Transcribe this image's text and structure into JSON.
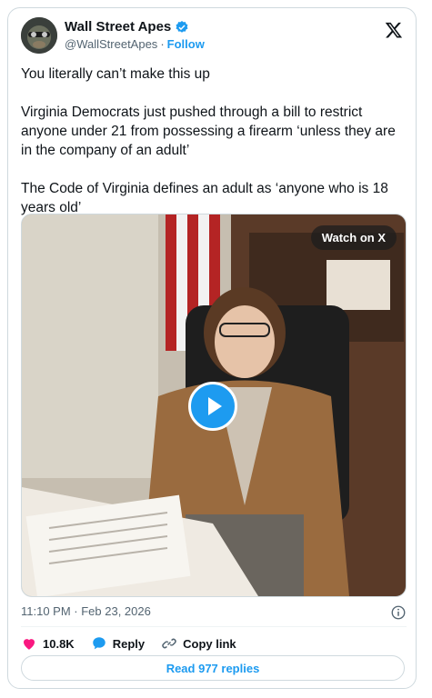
{
  "author": {
    "name": "Wall Street Apes",
    "handle": "@WallStreetApes",
    "separator": "·",
    "follow_label": "Follow",
    "verified_color": "#1d9bf0"
  },
  "tweet": {
    "paragraphs": [
      "You literally can’t make this up",
      "Virginia Democrats just pushed through a bill to restrict anyone under 21 from possessing a firearm ‘unless they are in the company of an adult’",
      "The Code of Virginia defines an adult as ‘anyone who is 18 years old’"
    ]
  },
  "media": {
    "watch_label": "Watch on X"
  },
  "meta": {
    "timestamp": "11:10 PM · Feb 23, 2026"
  },
  "actions": {
    "likes": "10.8K",
    "reply_label": "Reply",
    "copy_label": "Copy link"
  },
  "read_replies_label": "Read 977 replies",
  "colors": {
    "accent": "#1d9bf0",
    "like": "#f91880",
    "border": "#cfd9de"
  }
}
